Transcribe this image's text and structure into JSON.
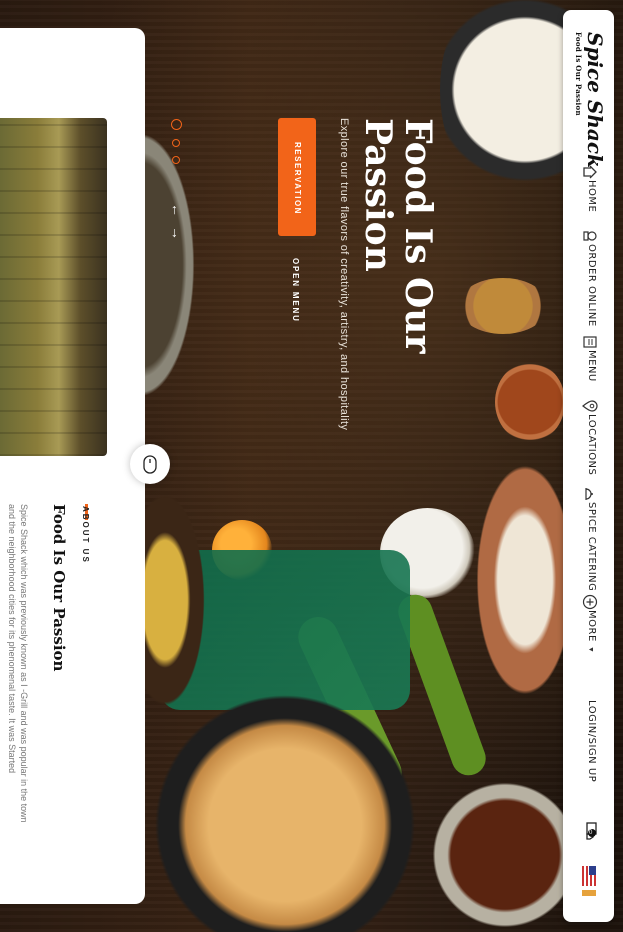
{
  "brand": {
    "name": "Spice Shack",
    "tagline": "Food Is Our Passion"
  },
  "nav": {
    "items": [
      {
        "label": "HOME",
        "icon": "home-icon"
      },
      {
        "label": "ORDER ONLINE",
        "icon": "chef-icon"
      },
      {
        "label": "MENU",
        "icon": "menu-book-icon"
      },
      {
        "label": "LOCATIONS",
        "icon": "location-icon"
      },
      {
        "label": "SPICE CATERING",
        "icon": "catering-cloche-icon"
      },
      {
        "label": "MORE",
        "icon": "plus-circle-icon"
      }
    ],
    "login_label": "LOGIN/SIGN UP",
    "cart_count": "0",
    "language_icon": "us-flag-icon"
  },
  "hero": {
    "title_line1": "Food Is Our",
    "title_line2": "Passion",
    "subtitle": "Explore our true flavors of creativity, artistry, and hospitality",
    "reservation_label": "RESERVATION",
    "open_menu_label": "OPEN MENU",
    "slider_dots": 3,
    "active_dot": 1
  },
  "about": {
    "eyebrow": "ABOUT US",
    "title": "Food Is Our Passion",
    "body": "Spice Shack which was previously known as I -Grill and was popular in the town and the neighborhood cities for its phenomenal taste. It was Started"
  },
  "colors": {
    "accent": "#f26419",
    "nav_bg": "#ffffff",
    "wood": "#3a2414"
  }
}
